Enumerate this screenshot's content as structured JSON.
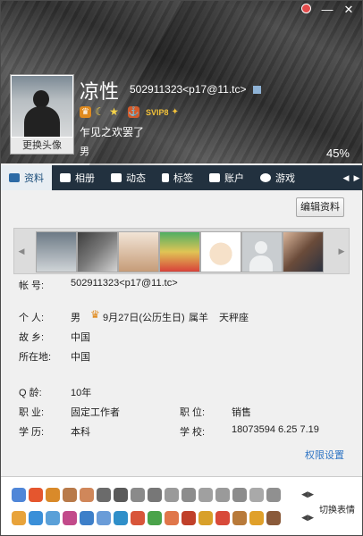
{
  "window": {
    "buttons": [
      "▾",
      "—",
      "✕"
    ]
  },
  "profile": {
    "nickname": "凉性",
    "account": "502911323<p17@11.tc>",
    "change_avatar": "更换头像",
    "signature": "乍见之欢罢了",
    "gender": "男",
    "percent": "45%",
    "vip_label": "SVIP8"
  },
  "tabs": [
    "资料",
    "相册",
    "动态",
    "标签",
    "账户",
    "游戏"
  ],
  "actions": {
    "edit": "编辑资料",
    "permissions": "权限设置",
    "switch": "切换表情"
  },
  "info": {
    "account_label": "帐 号:",
    "account_value": "502911323<p17@11.tc>",
    "personal_label": "个 人:",
    "personal_gender": "男",
    "personal_birthday": "9月27日(公历生日)",
    "personal_zodiac": "属羊",
    "personal_star": "天秤座",
    "hometown_label": "故 乡:",
    "hometown_value": "中国",
    "location_label": "所在地:",
    "location_value": "中国",
    "qage_label": "Q 龄:",
    "qage_value": "10年",
    "job_label": "职 业:",
    "job_value": "固定工作者",
    "position_label": "职 位:",
    "position_value": "销售",
    "edu_label": "学 历:",
    "edu_value": "本科",
    "school_label": "学 校:",
    "school_value": "18073594 6.25 7.19"
  },
  "colors": {
    "tabbar": "#22313f",
    "link": "#2e74c4",
    "accent_vip": "#f3c23a"
  }
}
